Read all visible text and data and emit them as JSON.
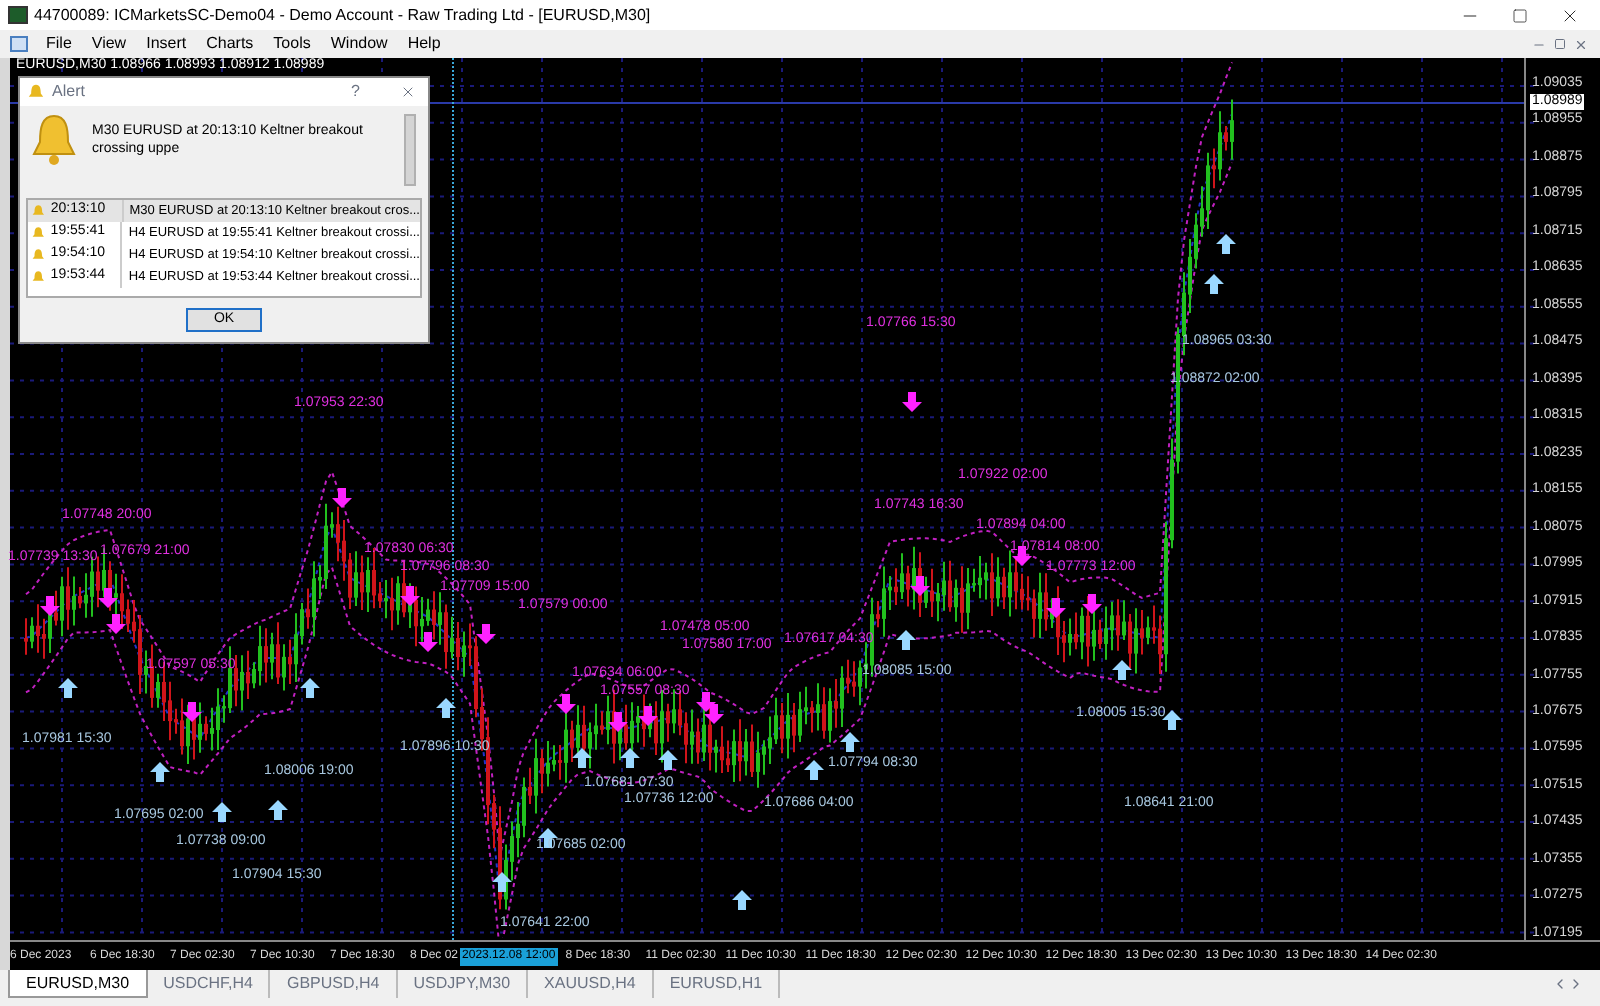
{
  "window": {
    "title": "44700089: ICMarketsSC-Demo04 - Demo Account - Raw Trading Ltd - [EURUSD,M30]"
  },
  "menu": [
    "File",
    "View",
    "Insert",
    "Charts",
    "Tools",
    "Window",
    "Help"
  ],
  "chart": {
    "header": "EURUSD,M30  1.08966 1.08993 1.08912 1.08989",
    "price_labels": [
      "1.09035",
      "1.08955",
      "1.08875",
      "1.08795",
      "1.08715",
      "1.08635",
      "1.08555",
      "1.08475",
      "1.08395",
      "1.08315",
      "1.08235",
      "1.08155",
      "1.08075",
      "1.07995",
      "1.07915",
      "1.07835",
      "1.07755",
      "1.07675",
      "1.07595",
      "1.07515",
      "1.07435",
      "1.07355",
      "1.07275",
      "1.07195"
    ],
    "current_price": "1.08989",
    "time_labels": [
      "6 Dec 2023",
      "6 Dec 18:30",
      "7 Dec 02:30",
      "7 Dec 10:30",
      "7 Dec 18:30",
      "8 Dec 02",
      "8 Dec 18:30",
      "11 Dec 02:30",
      "11 Dec 10:30",
      "11 Dec 18:30",
      "12 Dec 02:30",
      "12 Dec 10:30",
      "12 Dec 18:30",
      "13 Dec 02:30",
      "13 Dec 10:30",
      "13 Dec 18:30",
      "14 Dec 02:30"
    ],
    "crosshair_time": "2023.12.08 12:00",
    "sell_labels": [
      "1.07953 22:30",
      "1.07748 20:00",
      "1.07739 13:30",
      "1.07679 21:00",
      "1.07597 05:30",
      "1.07830 06:30",
      "1.07796 08:30",
      "1.07709 15:00",
      "1.07579 00:00",
      "1.07478 05:00",
      "1.07580 17:00",
      "1.07634 06:00",
      "1.07557 08:30",
      "1.07617 04:30",
      "1.07766 15:30",
      "1.07922 02:00",
      "1.07743 16:30",
      "1.07894 04:00",
      "1.07814 08:00",
      "1.07773 12:00"
    ],
    "buy_labels": [
      "1.07981 15:30",
      "1.08006 19:00",
      "1.07896 10:30",
      "1.07695 02:00",
      "1.07738 09:00",
      "1.07904 15:30",
      "1.07641 22:00",
      "1.07681 07:30",
      "1.07736 12:00",
      "1.07685 02:00",
      "1.07686 04:00",
      "1.07794 08:30",
      "1.08085 15:00",
      "1.08005 15:30",
      "1.08641 21:00",
      "1.08965 03:30",
      "1.08872 02:00"
    ]
  },
  "alert": {
    "title": "Alert",
    "help": "?",
    "message": "M30 EURUSD at 20:13:10 Keltner breakout  crossing uppe",
    "rows": [
      {
        "time": "20:13:10",
        "text": "M30 EURUSD at 20:13:10 Keltner breakout  cros...",
        "selected": true
      },
      {
        "time": "19:55:41",
        "text": "H4 EURUSD at 19:55:41 Keltner breakout  crossi...",
        "selected": false
      },
      {
        "time": "19:54:10",
        "text": "H4 EURUSD at 19:54:10 Keltner breakout  crossi...",
        "selected": false
      },
      {
        "time": "19:53:44",
        "text": "H4 EURUSD at 19:53:44 Keltner breakout  crossi...",
        "selected": false
      }
    ],
    "ok": "OK"
  },
  "tabs": [
    {
      "label": "EURUSD,M30",
      "selected": true
    },
    {
      "label": "USDCHF,H4",
      "selected": false
    },
    {
      "label": "GBPUSD,H4",
      "selected": false
    },
    {
      "label": "USDJPY,M30",
      "selected": false
    },
    {
      "label": "XAUUSD,H4",
      "selected": false
    },
    {
      "label": "EURUSD,H1",
      "selected": false
    }
  ]
}
